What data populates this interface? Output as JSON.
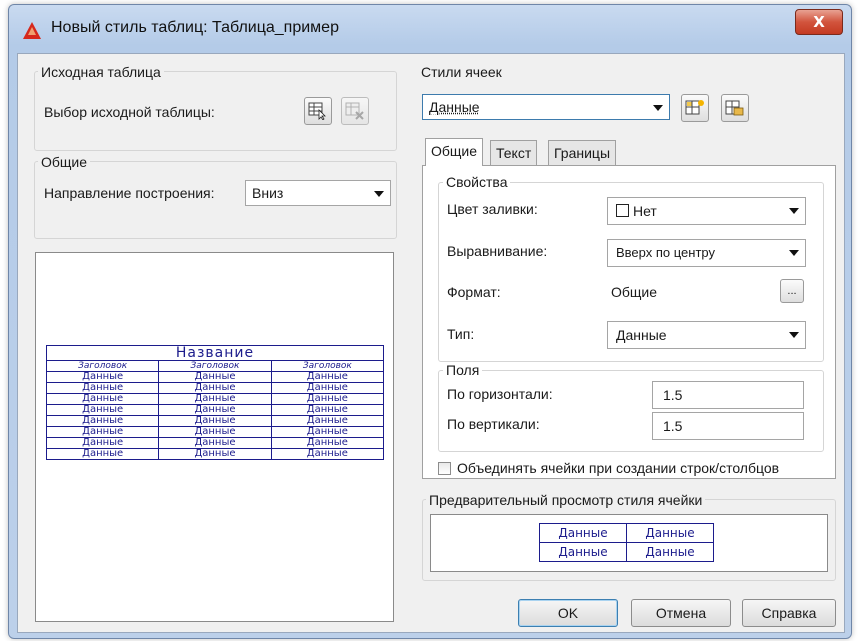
{
  "window": {
    "title": "Новый стиль таблиц: Таблица_пример",
    "close_glyph": "X"
  },
  "source_table": {
    "group_title": "Исходная таблица",
    "select_label": "Выбор исходной таблицы:"
  },
  "general": {
    "group_title": "Общие",
    "direction_label": "Направление построения:",
    "direction_value": "Вниз"
  },
  "sample_table": {
    "title": "Название",
    "headers": [
      "Заголовок",
      "Заголовок",
      "Заголовок"
    ],
    "rows": [
      [
        "Данные",
        "Данные",
        "Данные"
      ],
      [
        "Данные",
        "Данные",
        "Данные"
      ],
      [
        "Данные",
        "Данные",
        "Данные"
      ],
      [
        "Данные",
        "Данные",
        "Данные"
      ],
      [
        "Данные",
        "Данные",
        "Данные"
      ],
      [
        "Данные",
        "Данные",
        "Данные"
      ],
      [
        "Данные",
        "Данные",
        "Данные"
      ],
      [
        "Данные",
        "Данные",
        "Данные"
      ]
    ]
  },
  "cell_styles": {
    "group_title": "Стили ячеек",
    "selected": "Данные"
  },
  "tabs": [
    {
      "label": "Общие",
      "active": true
    },
    {
      "label": "Текст",
      "active": false
    },
    {
      "label": "Границы",
      "active": false
    }
  ],
  "properties": {
    "group_title": "Свойства",
    "fill_color_label": "Цвет заливки:",
    "fill_color_value": "Нет",
    "alignment_label": "Выравнивание:",
    "alignment_value": "Вверх по центру",
    "format_label": "Формат:",
    "format_value": "Общие",
    "format_button": "...",
    "type_label": "Тип:",
    "type_value": "Данные"
  },
  "margins": {
    "group_title": "Поля",
    "horizontal_label": "По горизонтали:",
    "horizontal_value": "1.5",
    "vertical_label": "По вертикали:",
    "vertical_value": "1.5"
  },
  "merge_cells": {
    "label": "Объединять ячейки при создании строк/столбцов",
    "checked": false
  },
  "cell_preview": {
    "group_title": "Предварительный просмотр стиля ячейки",
    "cells": [
      [
        "Данные",
        "Данные"
      ],
      [
        "Данные",
        "Данные"
      ]
    ]
  },
  "buttons": {
    "ok": "OK",
    "cancel": "Отмена",
    "help": "Справка"
  },
  "colors": {
    "cad_table": "#1c1c8c",
    "close_button": "#c43a22",
    "app_icon": "#d6281c"
  }
}
